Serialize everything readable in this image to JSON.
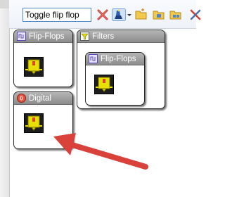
{
  "search": {
    "value": "Toggle flip flop"
  },
  "panels": {
    "flipflops_top": {
      "title": "Flip-Flops"
    },
    "filters": {
      "title": "Filters"
    },
    "flipflops_nested": {
      "title": "Flip-Flops"
    },
    "digital": {
      "title": "Digital"
    }
  },
  "colors": {
    "accent_red": "#d9423a",
    "component_yellow": "#e8e000",
    "panel_header": "#9a9a9a"
  },
  "icons": [
    "clear-search-icon",
    "wizard-icon",
    "dropdown-icon",
    "folder-icon",
    "folder-up-icon",
    "folder-settings-icon",
    "tools-icon"
  ]
}
